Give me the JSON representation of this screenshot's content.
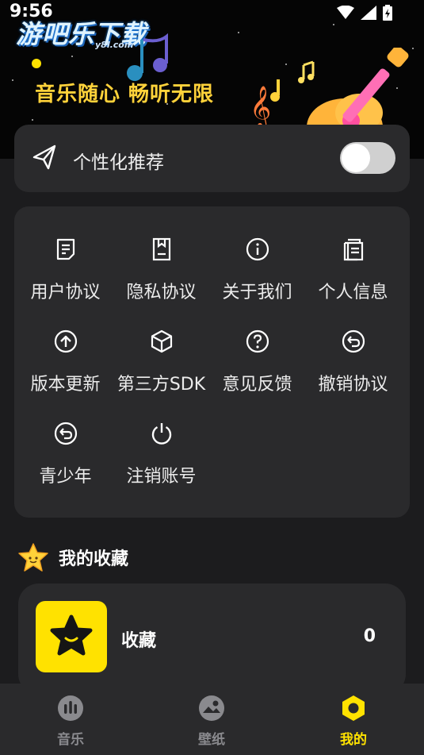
{
  "status_bar": {
    "time": "9:56"
  },
  "banner": {
    "logo": "游吧乐下载",
    "logo_sub": "y8l.com",
    "slogan": "音乐随心 畅听无限"
  },
  "recommend": {
    "label": "个性化推荐",
    "enabled": false
  },
  "menu": {
    "items": [
      {
        "label": "用户协议",
        "icon": "document-icon"
      },
      {
        "label": "隐私协议",
        "icon": "privacy-book-icon"
      },
      {
        "label": "关于我们",
        "icon": "info-icon"
      },
      {
        "label": "个人信息",
        "icon": "copy-document-icon"
      },
      {
        "label": "版本更新",
        "icon": "upload-circle-icon"
      },
      {
        "label": "第三方SDK",
        "icon": "cube-icon"
      },
      {
        "label": "意见反馈",
        "icon": "question-circle-icon"
      },
      {
        "label": "撤销协议",
        "icon": "undo-circle-icon"
      },
      {
        "label": "青少年",
        "icon": "undo-circle-icon"
      },
      {
        "label": "注销账号",
        "icon": "power-icon"
      }
    ]
  },
  "favorites": {
    "title": "我的收藏",
    "item": {
      "label": "收藏",
      "count": "0"
    }
  },
  "tabs": [
    {
      "label": "音乐",
      "icon": "music-icon",
      "active": false
    },
    {
      "label": "壁纸",
      "icon": "wallpaper-icon",
      "active": false
    },
    {
      "label": "我的",
      "icon": "profile-hexagon-icon",
      "active": true
    }
  ],
  "colors": {
    "accent": "#ffe200",
    "background": "#1c1c1e",
    "card": "#2a2a2c",
    "inactive_tab": "#8a8a8e"
  }
}
